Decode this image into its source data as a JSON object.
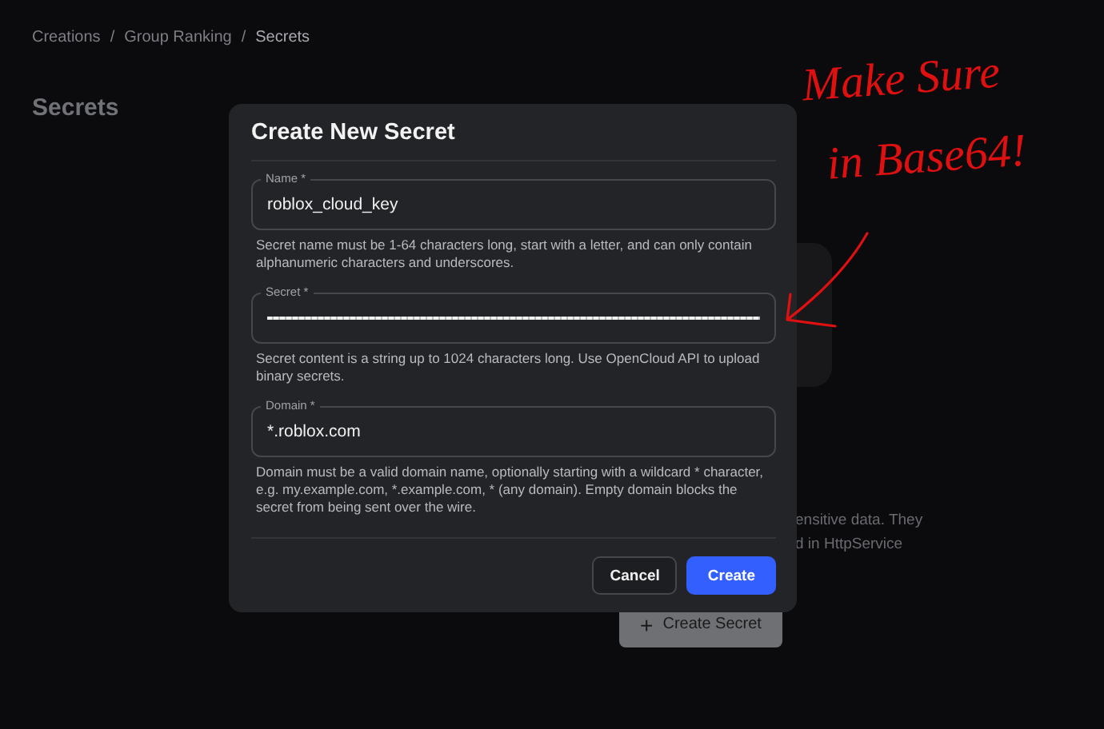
{
  "breadcrumb": [
    {
      "kind": "link",
      "label": "Creations",
      "current": false
    },
    {
      "kind": "separator",
      "label": "/"
    },
    {
      "kind": "link",
      "label": "Group Ranking",
      "current": false
    },
    {
      "kind": "separator",
      "label": "/"
    },
    {
      "kind": "link",
      "label": "Secrets",
      "current": true
    }
  ],
  "page_title": "Secrets",
  "background_text": [
    "ensitive data. They",
    "d in HttpService"
  ],
  "create_secret_button": {
    "icon": "+",
    "label": "Create Secret"
  },
  "dialog": {
    "title": "Create New Secret",
    "fields": [
      {
        "kind": "text",
        "label": "Name *",
        "value": "roblox_cloud_key",
        "help": "Secret name must be 1-64 characters long, start with a letter, and can only contain alphanumeric characters and underscores."
      },
      {
        "kind": "masked",
        "label": "Secret *",
        "help": "Secret content is a string up to 1024 characters long. Use OpenCloud API to upload binary secrets."
      },
      {
        "kind": "text",
        "label": "Domain *",
        "value": "*.roblox.com",
        "help": "Domain must be a valid domain name, optionally starting with a wildcard * character, e.g. my.example.com, *.example.com, * (any domain). Empty domain blocks the secret from being sent over the wire."
      }
    ],
    "buttons": [
      {
        "label": "Cancel",
        "kind": "secondary"
      },
      {
        "label": "Create",
        "kind": "primary"
      }
    ]
  },
  "annotation": {
    "lines": [
      "Make Sure",
      "in Base64!"
    ]
  }
}
